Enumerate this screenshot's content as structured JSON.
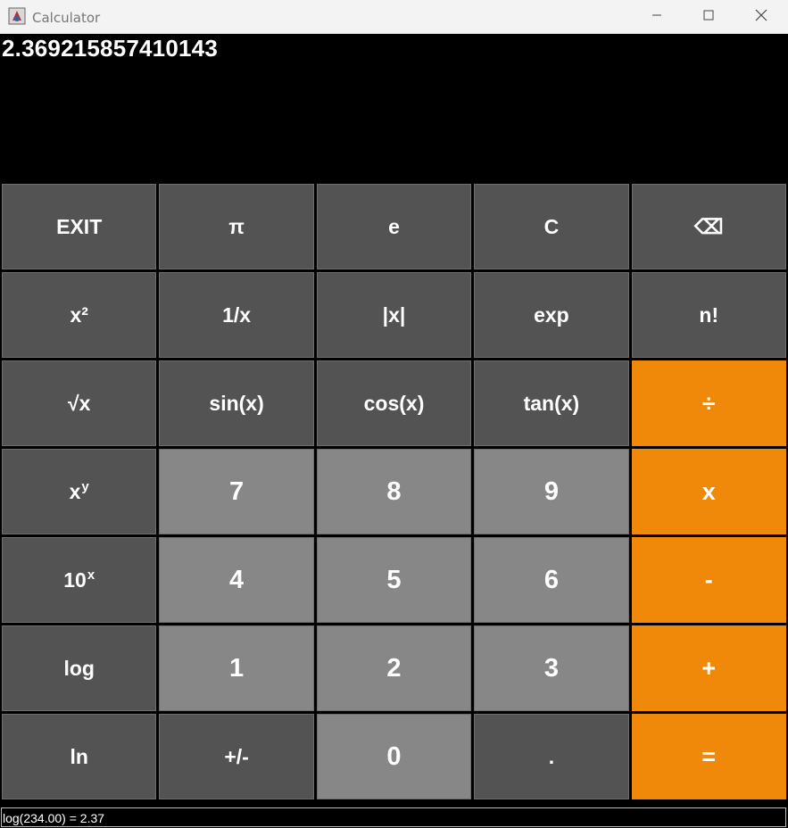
{
  "window": {
    "title": "Calculator",
    "controls": [
      "minimize",
      "maximize",
      "close"
    ]
  },
  "display": {
    "value": "2.369215857410143"
  },
  "status_bar": {
    "text": "log(234.00) = 2.37"
  },
  "colors": {
    "function_key": "#535353",
    "digit_key": "#878787",
    "operator_key": "#f0890a",
    "display_background": "#000000",
    "text": "#ffffff"
  },
  "keys": [
    {
      "name": "exit-button",
      "label": "EXIT",
      "kind": "func"
    },
    {
      "name": "pi-button",
      "label": "π",
      "kind": "func"
    },
    {
      "name": "e-button",
      "label": "e",
      "kind": "func"
    },
    {
      "name": "clear-button",
      "label": "C",
      "kind": "func"
    },
    {
      "name": "backspace-button",
      "label": "⌫",
      "kind": "func"
    },
    {
      "name": "square-button",
      "label": "x²",
      "kind": "func"
    },
    {
      "name": "reciprocal-button",
      "label": "1/x",
      "kind": "func"
    },
    {
      "name": "absolute-button",
      "label": "|x|",
      "kind": "func"
    },
    {
      "name": "exp-button",
      "label": "exp",
      "kind": "func"
    },
    {
      "name": "factorial-button",
      "label": "n!",
      "kind": "func"
    },
    {
      "name": "sqrt-button",
      "label": "√x",
      "kind": "func"
    },
    {
      "name": "sin-button",
      "label": "sin(x)",
      "kind": "func"
    },
    {
      "name": "cos-button",
      "label": "cos(x)",
      "kind": "func"
    },
    {
      "name": "tan-button",
      "label": "tan(x)",
      "kind": "func"
    },
    {
      "name": "divide-button",
      "label": "÷",
      "kind": "op"
    },
    {
      "name": "power-button",
      "label": "x",
      "sup": "y",
      "kind": "func"
    },
    {
      "name": "digit-7-button",
      "label": "7",
      "kind": "num"
    },
    {
      "name": "digit-8-button",
      "label": "8",
      "kind": "num"
    },
    {
      "name": "digit-9-button",
      "label": "9",
      "kind": "num"
    },
    {
      "name": "multiply-button",
      "label": "x",
      "kind": "op"
    },
    {
      "name": "ten-power-button",
      "label": "10",
      "sup": "x",
      "kind": "func"
    },
    {
      "name": "digit-4-button",
      "label": "4",
      "kind": "num"
    },
    {
      "name": "digit-5-button",
      "label": "5",
      "kind": "num"
    },
    {
      "name": "digit-6-button",
      "label": "6",
      "kind": "num"
    },
    {
      "name": "subtract-button",
      "label": "-",
      "kind": "op"
    },
    {
      "name": "log-button",
      "label": "log",
      "kind": "func"
    },
    {
      "name": "digit-1-button",
      "label": "1",
      "kind": "num"
    },
    {
      "name": "digit-2-button",
      "label": "2",
      "kind": "num"
    },
    {
      "name": "digit-3-button",
      "label": "3",
      "kind": "num"
    },
    {
      "name": "add-button",
      "label": "+",
      "kind": "op"
    },
    {
      "name": "ln-button",
      "label": "ln",
      "kind": "func"
    },
    {
      "name": "negate-button",
      "label": "+/-",
      "kind": "func"
    },
    {
      "name": "digit-0-button",
      "label": "0",
      "kind": "num"
    },
    {
      "name": "decimal-button",
      "label": ".",
      "kind": "func"
    },
    {
      "name": "equals-button",
      "label": "=",
      "kind": "op"
    }
  ]
}
